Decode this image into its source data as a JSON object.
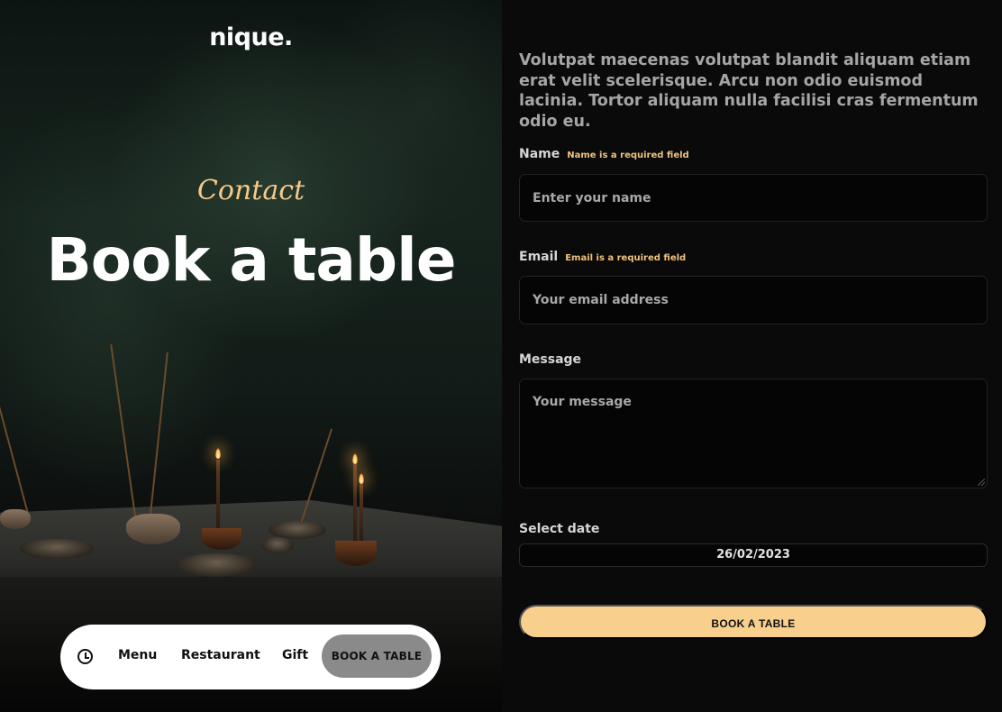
{
  "brand": {
    "logo_text": "nique."
  },
  "hero": {
    "eyebrow": "Contact",
    "title": "Book a table"
  },
  "nav": {
    "clock_icon": "clock-icon",
    "items": [
      "Menu",
      "Restaurant",
      "Gift"
    ],
    "cta_label": "BOOK A TABLE"
  },
  "form": {
    "intro": "Volutpat maecenas volutpat blandit aliquam etiam erat velit scelerisque. Arcu non odio euismod lacinia. Tortor aliquam nulla facilisi cras fermentum odio eu.",
    "name": {
      "label": "Name",
      "required_note": "Name is a required field",
      "placeholder": "Enter your name"
    },
    "email": {
      "label": "Email",
      "required_note": "Email is a required field",
      "placeholder": "Your email address"
    },
    "message": {
      "label": "Message",
      "placeholder": "Your message"
    },
    "date": {
      "label": "Select date",
      "value": "26/02/2023"
    },
    "submit_label": "BOOK A TABLE"
  },
  "colors": {
    "accent": "#f9cf8e",
    "accent_text": "#f2c281",
    "background": "#0a0a0a",
    "nav_cta_bg": "#8a8a8a"
  }
}
